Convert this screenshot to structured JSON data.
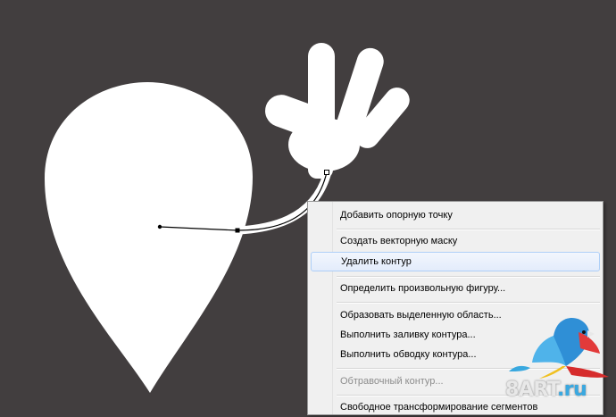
{
  "context_menu": {
    "items": [
      {
        "label": "Добавить опорную точку",
        "state": "enabled"
      },
      {
        "label": "Создать векторную маску",
        "state": "enabled"
      },
      {
        "label": "Удалить контур",
        "state": "hover"
      },
      {
        "label": "Определить произвольную фигуру...",
        "state": "enabled"
      },
      {
        "label": "Образовать выделенную область...",
        "state": "enabled"
      },
      {
        "label": "Выполнить заливку контура...",
        "state": "enabled"
      },
      {
        "label": "Выполнить обводку контура...",
        "state": "enabled"
      },
      {
        "label": "Обтравочный контур...",
        "state": "disabled"
      },
      {
        "label": "Свободное трансформирование сегментов",
        "state": "enabled"
      }
    ]
  },
  "watermark": {
    "brand": "8ART",
    "domain": ".ru",
    "icon": "parrot-icon"
  },
  "colors": {
    "canvas_background": "#423e3f",
    "shape_fill": "#ffffff",
    "menu_background": "#f0f0f0",
    "menu_hover": "#e3ecfb",
    "watermark_accent": "#3aa8e0"
  }
}
